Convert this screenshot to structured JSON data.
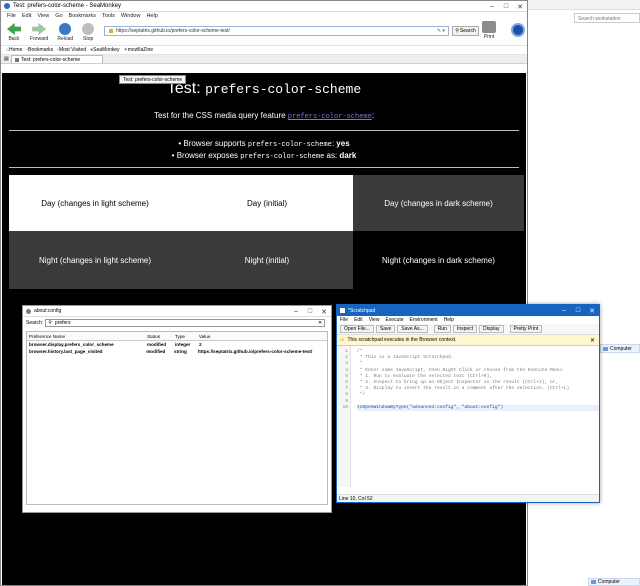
{
  "desktop": {
    "right_search_placeholder": "Search workstation",
    "computer_label": "Computer",
    "computer_label_bottom": "Computer"
  },
  "browser": {
    "title": "Test: prefers-color-scheme - SeaMonkey",
    "menu": [
      "File",
      "Edit",
      "View",
      "Go",
      "Bookmarks",
      "Tools",
      "Window",
      "Help"
    ],
    "toolbar": {
      "back": "Back",
      "forward": "Forward",
      "reload": "Reload",
      "stop": "Stop",
      "url": "https://septatrix.github.io/prefers-color-scheme-test/",
      "search": "Search",
      "print": "Print"
    },
    "bookmarks": [
      "Home",
      "Bookmarks",
      "Most Visited",
      "SeaMonkey",
      "mozillaZine"
    ],
    "tab_label": "Test: prefers-color-scheme",
    "tooltip": "Test: prefers-color-scheme"
  },
  "page": {
    "heading_prefix": "Test: ",
    "heading_code": "prefers-color-scheme",
    "intro_text": "Test for the CSS media query feature",
    "intro_link": "prefers-color-scheme",
    "intro_suffix": ":",
    "bullets": [
      {
        "prefix": "Browser supports ",
        "code": "prefers-color-scheme",
        "mid": ": ",
        "value": "yes"
      },
      {
        "prefix": "Browser exposes ",
        "code": "prefers-color-scheme",
        "mid": " as: ",
        "value": "dark"
      }
    ],
    "day_row": [
      "Day (changes in light scheme)",
      "Day (initial)",
      "Day (changes in dark scheme)"
    ],
    "night_row": [
      "Night (changes in light scheme)",
      "Night (initial)",
      "Night (changes in dark scheme)"
    ]
  },
  "aboutconfig": {
    "title": "about:config",
    "search_label": "Search:",
    "search_value": "prefers",
    "columns": [
      "Preference Name",
      "Status",
      "Type",
      "Value"
    ],
    "rows": [
      [
        "browser.display.prefers_color_scheme",
        "modified",
        "integer",
        "2"
      ],
      [
        "browser.history.last_page_visited",
        "modified",
        "string",
        "https://septatrix.github.io/prefers-color-scheme-test/"
      ]
    ]
  },
  "scratchpad": {
    "title": "*Scratchpad",
    "menu": [
      "File",
      "Edit",
      "View",
      "Execute",
      "Environment",
      "Help"
    ],
    "buttons": [
      "Open File...",
      "Save",
      "Save As...",
      "Run",
      "Inspect",
      "Display",
      "Pretty Print"
    ],
    "notice": "This scratchpad executes in the Browser context.",
    "lines": [
      {
        "n": "1",
        "t": "/*"
      },
      {
        "n": "2",
        "t": " * This is a JavaScript Scratchpad."
      },
      {
        "n": "3",
        "t": " *"
      },
      {
        "n": "4",
        "t": " * Enter some JavaScript, then Right Click or choose from the Execute Menu:"
      },
      {
        "n": "5",
        "t": " * 1. Run to evaluate the selected text (Ctrl+R),"
      },
      {
        "n": "6",
        "t": " * 2. Inspect to bring up an Object Inspector on the result (Ctrl+I), or,"
      },
      {
        "n": "7",
        "t": " * 3. Display to insert the result in a comment after the selection. (Ctrl+L)"
      },
      {
        "n": "8",
        "t": " */"
      },
      {
        "n": "9",
        "t": ""
      },
      {
        "n": "10",
        "t": "toOpenWindowByType(\"advanced:config\", \"about:config\")"
      }
    ],
    "status": "Line 10, Col 52"
  },
  "colors": {
    "titlebar_active": "#1565c0",
    "link": "#8a6fd6",
    "code_blue": "#1a4fb0"
  }
}
